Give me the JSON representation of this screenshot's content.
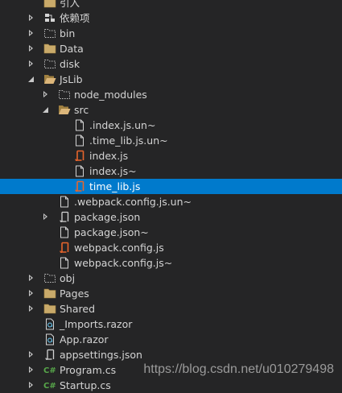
{
  "tree": [
    {
      "label": "引入",
      "depth": 1,
      "expander": "none",
      "icon": "folder-icon"
    },
    {
      "label": "依赖项",
      "depth": 1,
      "expander": "collapsed",
      "icon": "dependencies-icon"
    },
    {
      "label": "bin",
      "depth": 1,
      "expander": "collapsed",
      "icon": "folder-dashed-icon"
    },
    {
      "label": "Data",
      "depth": 1,
      "expander": "collapsed",
      "icon": "folder-icon"
    },
    {
      "label": "disk",
      "depth": 1,
      "expander": "collapsed",
      "icon": "folder-dashed-icon"
    },
    {
      "label": "JsLib",
      "depth": 1,
      "expander": "expanded",
      "icon": "folder-open-icon"
    },
    {
      "label": "node_modules",
      "depth": 2,
      "expander": "collapsed",
      "icon": "folder-dashed-icon"
    },
    {
      "label": "src",
      "depth": 2,
      "expander": "expanded",
      "icon": "folder-open-icon"
    },
    {
      "label": ".index.js.un~",
      "depth": 3,
      "expander": "none",
      "icon": "file-icon"
    },
    {
      "label": ".time_lib.js.un~",
      "depth": 3,
      "expander": "none",
      "icon": "file-icon"
    },
    {
      "label": "index.js",
      "depth": 3,
      "expander": "none",
      "icon": "js-file-icon"
    },
    {
      "label": "index.js~",
      "depth": 3,
      "expander": "none",
      "icon": "file-icon"
    },
    {
      "label": "time_lib.js",
      "depth": 3,
      "expander": "none",
      "icon": "js-file-icon",
      "selected": true
    },
    {
      "label": ".webpack.config.js.un~",
      "depth": 2,
      "expander": "none",
      "icon": "file-icon"
    },
    {
      "label": "package.json",
      "depth": 2,
      "expander": "collapsed",
      "icon": "json-file-icon"
    },
    {
      "label": "package.json~",
      "depth": 2,
      "expander": "none",
      "icon": "file-icon"
    },
    {
      "label": "webpack.config.js",
      "depth": 2,
      "expander": "none",
      "icon": "js-file-icon"
    },
    {
      "label": "webpack.config.js~",
      "depth": 2,
      "expander": "none",
      "icon": "file-icon"
    },
    {
      "label": "obj",
      "depth": 1,
      "expander": "collapsed",
      "icon": "folder-dashed-icon"
    },
    {
      "label": "Pages",
      "depth": 1,
      "expander": "collapsed",
      "icon": "folder-icon"
    },
    {
      "label": "Shared",
      "depth": 1,
      "expander": "collapsed",
      "icon": "folder-icon"
    },
    {
      "label": "_Imports.razor",
      "depth": 1,
      "expander": "none",
      "icon": "razor-file-icon"
    },
    {
      "label": "App.razor",
      "depth": 1,
      "expander": "none",
      "icon": "razor-file-icon"
    },
    {
      "label": "appsettings.json",
      "depth": 1,
      "expander": "collapsed",
      "icon": "json-file-icon"
    },
    {
      "label": "Program.cs",
      "depth": 1,
      "expander": "collapsed",
      "icon": "csharp-file-icon"
    },
    {
      "label": "Startup.cs",
      "depth": 1,
      "expander": "collapsed",
      "icon": "csharp-file-icon"
    }
  ],
  "watermark": "https://blog.csdn.net/u010279498",
  "colors": {
    "background": "#252526",
    "text": "#d4d4d4",
    "selection": "#007acc",
    "folder": "#c9aa6a",
    "js_icon": "#e8652c",
    "csharp_icon": "#57a64a"
  }
}
